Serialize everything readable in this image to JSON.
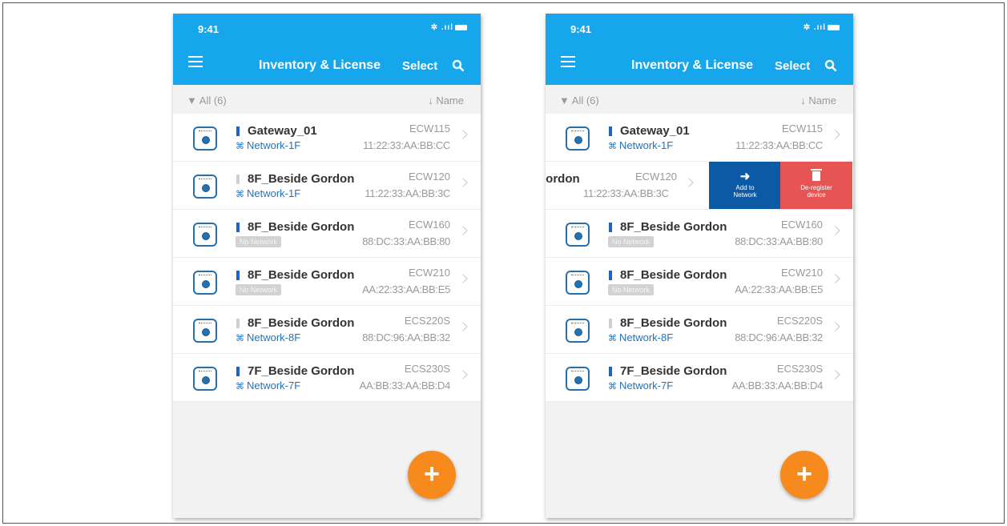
{
  "status_bar": {
    "time": "9:41",
    "icons": "✲ .ııl"
  },
  "app_bar": {
    "title": "Inventory & License",
    "select_label": "Select"
  },
  "sort_bar": {
    "filter_label": "All (6)",
    "sort_label": "Name"
  },
  "fab_label": "+",
  "devices": [
    {
      "name": "Gateway_01",
      "network": "Network-1F",
      "model": "ECW115",
      "mac": "11:22:33:AA:BB:CC",
      "signal": "on"
    },
    {
      "name": "8F_Beside Gordon",
      "network": "Network-1F",
      "model": "ECW120",
      "mac": "11:22:33:AA:BB:3C",
      "signal": "off"
    },
    {
      "name": "8F_Beside Gordon",
      "network": "No Network",
      "model": "ECW160",
      "mac": "88:DC:33:AA:BB:80",
      "signal": "on"
    },
    {
      "name": "8F_Beside Gordon",
      "network": "No Network",
      "model": "ECW210",
      "mac": "AA:22:33:AA:BB:E5",
      "signal": "on"
    },
    {
      "name": "8F_Beside Gordon",
      "network": "Network-8F",
      "model": "ECS220S",
      "mac": "88:DC:96:AA:BB:32",
      "signal": "off"
    },
    {
      "name": "7F_Beside Gordon",
      "network": "Network-7F",
      "model": "ECS230S",
      "mac": "AA:BB:33:AA:BB:D4",
      "signal": "on"
    }
  ],
  "swipe_row": {
    "name_fragment": "iordon",
    "model": "ECW120",
    "mac": "11:22:33:AA:BB:3C",
    "add_action": {
      "line1": "Add to",
      "line2": "Network"
    },
    "delete_action": {
      "line1": "De-register",
      "line2": "device"
    }
  },
  "colors": {
    "app_bar": "#16a6ec",
    "fab": "#f68a1c",
    "add_action": "#0c59a6",
    "delete_action": "#e75454",
    "network_text": "#1f72c2"
  }
}
